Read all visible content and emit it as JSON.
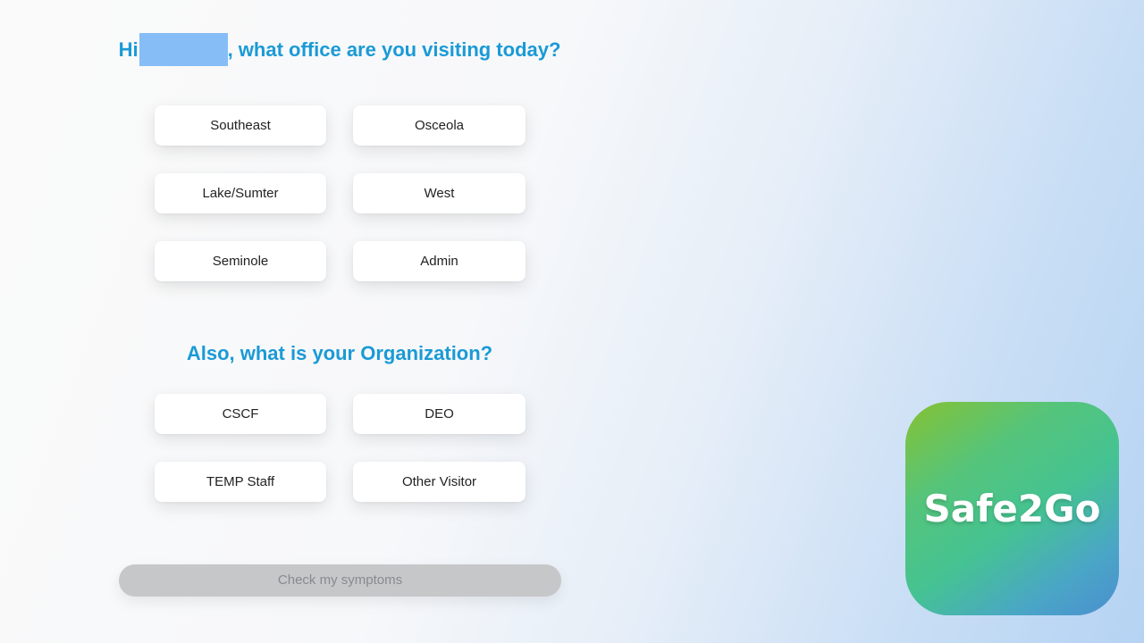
{
  "office_question": {
    "greeting": "Hi",
    "rest": ", what office are you visiting today?"
  },
  "offices": [
    {
      "label": "Southeast"
    },
    {
      "label": "Osceola"
    },
    {
      "label": "Lake/Sumter"
    },
    {
      "label": "West"
    },
    {
      "label": "Seminole"
    },
    {
      "label": "Admin"
    }
  ],
  "organization_question": {
    "text": "Also, what is your Organization?"
  },
  "organizations": [
    {
      "label": "CSCF"
    },
    {
      "label": "DEO"
    },
    {
      "label": "TEMP Staff"
    },
    {
      "label": "Other Visitor"
    }
  ],
  "submit": {
    "label": "Check my symptoms",
    "state": "disabled"
  },
  "logo": {
    "text": "Safe2Go"
  },
  "colors": {
    "heading": "#1a9ad6",
    "redaction": "#86bdf6",
    "button_bg": "#ffffff",
    "disabled_button_bg": "#c6c7c9",
    "logo_gradient_start": "#86c232",
    "logo_gradient_end": "#4a8fd0"
  }
}
